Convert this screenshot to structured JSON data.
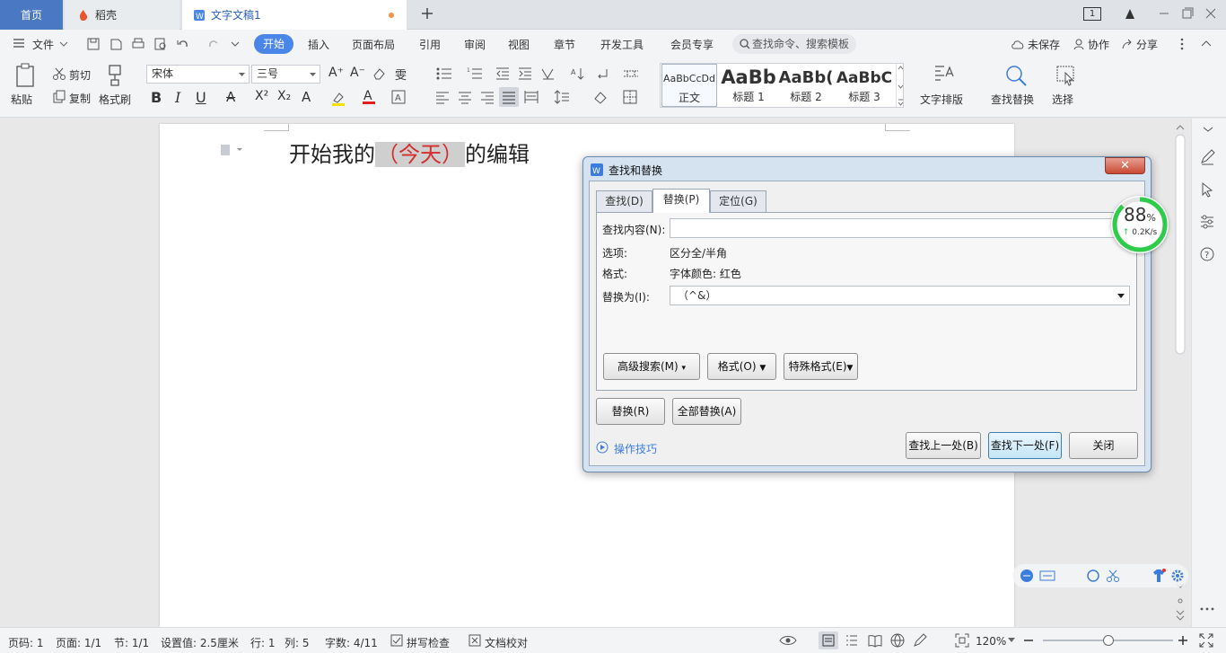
{
  "tabs": {
    "home": "首页",
    "daoke": "稻壳",
    "doc": "文字文稿1"
  },
  "window_controls": {
    "page_count": "1"
  },
  "menu": {
    "file": "文件",
    "items": [
      "开始",
      "插入",
      "页面布局",
      "引用",
      "审阅",
      "视图",
      "章节",
      "开发工具",
      "会员专享"
    ],
    "search_placeholder": "查找命令、搜索模板",
    "unsaved": "未保存",
    "collab": "协作",
    "share": "分享"
  },
  "ribbon": {
    "paste": "粘贴",
    "cut": "剪切",
    "copy": "复制",
    "format_painter": "格式刷",
    "font_name": "宋体",
    "font_size": "三号",
    "styles": [
      {
        "preview": "AaBbCcDd",
        "name": "正文"
      },
      {
        "preview": "AaBb",
        "name": "标题 1"
      },
      {
        "preview": "AaBb(",
        "name": "标题 2"
      },
      {
        "preview": "AaBbC",
        "name": "标题 3"
      }
    ],
    "text_layout": "文字排版",
    "find_replace": "查找替换",
    "select": "选择"
  },
  "document": {
    "text_before": "开始我的",
    "highlight": "（今天）",
    "text_after": "的编辑"
  },
  "dialog": {
    "title": "查找和替换",
    "tabs": [
      "查找(D)",
      "替换(P)",
      "定位(G)"
    ],
    "find_label": "查找内容(N):",
    "find_value": "",
    "options_label": "选项:",
    "options_value": "区分全/半角",
    "format_label": "格式:",
    "format_value": "字体颜色: 红色",
    "replace_label": "替换为(I):",
    "replace_value": "（^&）",
    "btn_advanced": "高级搜索(M)",
    "btn_format": "格式(O)",
    "btn_special": "特殊格式(E)",
    "btn_replace": "替换(R)",
    "btn_replace_all": "全部替换(A)",
    "tips": "操作技巧",
    "btn_prev": "查找上一处(B)",
    "btn_next": "查找下一处(F)",
    "btn_close": "关闭"
  },
  "speed_widget": {
    "percent": "88",
    "percent_sign": "%",
    "rate": "0.2K/s",
    "level": 0.88
  },
  "statusbar": {
    "page_num": "页码: 1",
    "pages": "页面: 1/1",
    "section": "节: 1/1",
    "setting": "设置值: 2.5厘米",
    "row": "行: 1",
    "col": "列: 5",
    "words": "字数: 4/11",
    "spell": "拼写检查",
    "proof": "文档校对",
    "zoom": "120%"
  },
  "colors": {
    "accent": "#4a86e8",
    "highlight_text": "#d32f2f",
    "speed_ring": "#2ecc4a"
  }
}
